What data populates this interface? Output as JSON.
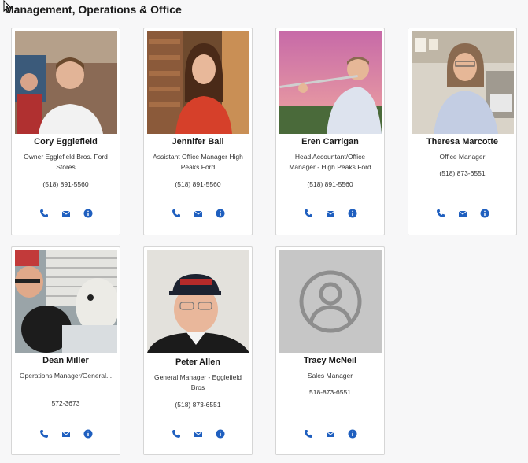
{
  "section": {
    "title": "Management, Operations & Office"
  },
  "accent": "#1f5fbf",
  "staff": [
    {
      "name": "Cory Egglefield",
      "title": "Owner Egglefield Bros. Ford Stores",
      "phone": "(518) 891-5560"
    },
    {
      "name": "Jennifer Ball",
      "title": "Assistant Office Manager High Peaks Ford",
      "phone": "(518) 891-5560"
    },
    {
      "name": "Eren Carrigan",
      "title": "Head Accountant/Office Manager - High Peaks Ford",
      "phone": "(518) 891-5560"
    },
    {
      "name": "Theresa Marcotte",
      "title": "Office Manager",
      "phone": "(518) 873-6551"
    },
    {
      "name": "Dean Miller",
      "title": "Operations Manager/General...",
      "phone": "572-3673"
    },
    {
      "name": "Peter Allen",
      "title": "General Manager - Egglefield Bros",
      "phone": "(518) 873-6551"
    },
    {
      "name": "Tracy McNeil",
      "title": "Sales Manager",
      "phone": "518-873-6551"
    }
  ],
  "icons": {
    "phone": "phone-icon",
    "email": "envelope-icon",
    "info": "info-icon"
  }
}
